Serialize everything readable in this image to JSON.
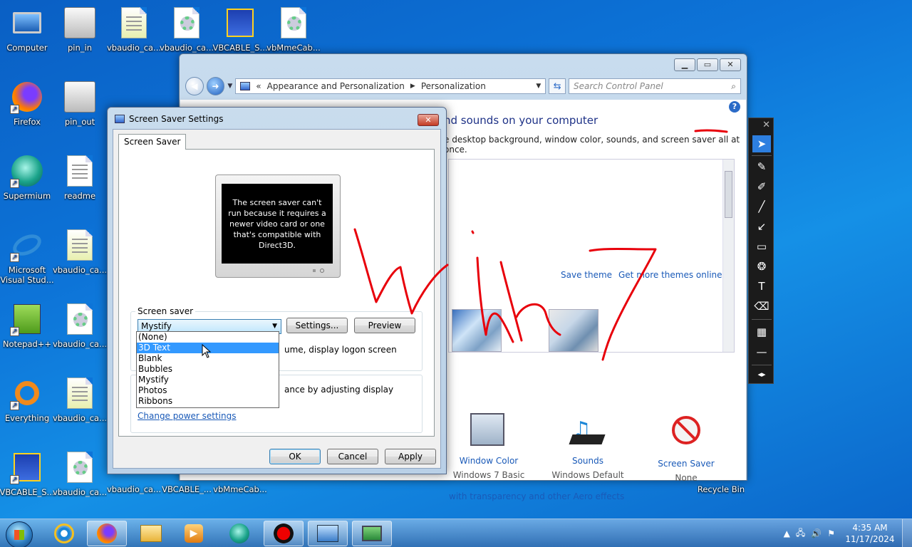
{
  "desktop": {
    "icons": [
      {
        "label": "Computer",
        "icon": "computer-icon"
      },
      {
        "label": "pin_in",
        "icon": "app-icon"
      },
      {
        "label": "vbaudio_ca...",
        "icon": "setup-icon"
      },
      {
        "label": "vbaudio_ca...",
        "icon": "settings-file-icon"
      },
      {
        "label": "VBCABLE_S...",
        "icon": "installer-icon"
      },
      {
        "label": "vbMmeCab...",
        "icon": "settings-file-icon"
      },
      {
        "label": "Firefox",
        "icon": "firefox-icon"
      },
      {
        "label": "pin_out",
        "icon": "app-icon"
      },
      {
        "label": "Supermium",
        "icon": "supermium-icon"
      },
      {
        "label": "readme",
        "icon": "text-file-icon"
      },
      {
        "label": "Microsoft Visual Stud...",
        "icon": "visual-studio-icon"
      },
      {
        "label": "vbaudio_ca...",
        "icon": "setup-icon"
      },
      {
        "label": "Notepad++",
        "icon": "notepadpp-icon"
      },
      {
        "label": "vbaudio_ca...",
        "icon": "settings-file-icon"
      },
      {
        "label": "Everything",
        "icon": "everything-icon"
      },
      {
        "label": "vbaudio_ca...",
        "icon": "setup-icon"
      },
      {
        "label": "VBCABLE_S...",
        "icon": "installer-icon"
      },
      {
        "label": "vbaudio_ca...",
        "icon": "settings-file-icon"
      },
      {
        "label": "vbaudio_ca...",
        "icon": "setup-icon"
      },
      {
        "label": "VBCABLE_...",
        "icon": "installer-icon"
      },
      {
        "label": "vbMmeCab...",
        "icon": "settings-file-icon"
      },
      {
        "label": "Recycle Bin",
        "icon": "recycle-bin-icon"
      }
    ]
  },
  "control_panel": {
    "breadcrumb_prefix": "«",
    "breadcrumb": [
      "Appearance and Personalization",
      "Personalization"
    ],
    "search_placeholder": "Search Control Panel",
    "heading": "nd sounds on your computer",
    "subheading": "e desktop background, window color, sounds, and screen saver all at once.",
    "save_theme": "Save theme",
    "get_more_themes": "Get more themes online",
    "bottom_items": [
      {
        "title": "Window Color",
        "sub": "Windows 7 Basic"
      },
      {
        "title": "Sounds",
        "sub": "Windows Default"
      },
      {
        "title": "Screen Saver",
        "sub": "None"
      }
    ],
    "aero_link": "with transparency and other Aero effects"
  },
  "screen_saver_dialog": {
    "title": "Screen Saver Settings",
    "tab": "Screen Saver",
    "preview_message": "The screen saver can't run because it requires a newer video card or one that's compatible with Direct3D.",
    "group_label": "Screen saver",
    "selected": "Mystify",
    "settings_button": "Settings...",
    "preview_button": "Preview",
    "resume_text": "ume, display logon screen",
    "power_text": "ance by adjusting display",
    "power_link": "Change power settings",
    "options": [
      "(None)",
      "3D Text",
      "Blank",
      "Bubbles",
      "Mystify",
      "Photos",
      "Ribbons"
    ],
    "highlighted_option": "3D Text",
    "ok": "OK",
    "cancel": "Cancel",
    "apply": "Apply"
  },
  "taskbar": {
    "time": "4:35 AM",
    "date": "11/17/2024",
    "apps": [
      "internet-explorer-icon",
      "firefox-icon",
      "file-explorer-icon",
      "media-player-icon",
      "supermium-icon",
      "record-icon",
      "control-panel-icon",
      "display-settings-icon"
    ]
  },
  "colors": {
    "desktop_blue": "#0d74d8",
    "link_blue": "#1a5ab8",
    "selection_blue": "#3399ff",
    "ink_red": "#e8000b"
  }
}
